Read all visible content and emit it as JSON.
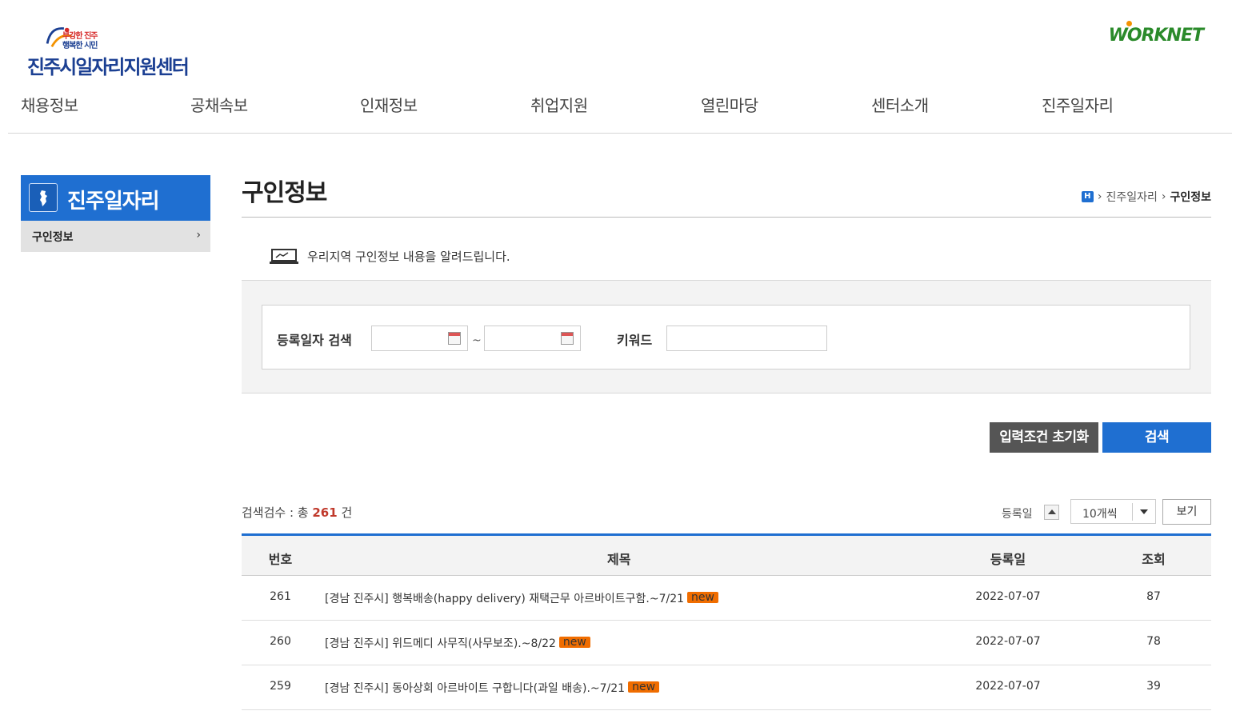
{
  "header": {
    "slogan_line1": "부강한 진주",
    "slogan_line2": "행복한 시민",
    "center_name": "진주시일자리지원센터",
    "worknet_logo": "WORKNET"
  },
  "gnb": [
    "채용정보",
    "공채속보",
    "인재정보",
    "취업지원",
    "열린마당",
    "센터소개",
    "진주일자리"
  ],
  "lnb": {
    "title": "진주일자리",
    "icon": "korea-map-icon",
    "items": [
      {
        "label": "구인정보"
      }
    ]
  },
  "page": {
    "title": "구인정보",
    "breadcrumb": [
      "진주일자리",
      "구인정보"
    ],
    "notice": "우리지역 구인정보 내용을 알려드립니다."
  },
  "search": {
    "date_label": "등록일자 검색",
    "tilde": "~",
    "keyword_label": "키워드",
    "start_date": "",
    "end_date": "",
    "keyword": "",
    "reset_button": "입력조건 초기화",
    "search_button": "검색"
  },
  "results": {
    "count_prefix": "검색검수 : 총",
    "count": "261",
    "count_suffix": "건",
    "sort_label": "등록일",
    "per_page": "10개씩",
    "view_button": "보기"
  },
  "table": {
    "headers": {
      "no": "번호",
      "title": "제목",
      "date": "등록일",
      "views": "조회"
    },
    "badge": "new",
    "rows": [
      {
        "no": "261",
        "title": "[경남 진주시] 행복배송(happy delivery) 재택근무 아르바이트구함.~7/21",
        "date": "2022-07-07",
        "views": "87"
      },
      {
        "no": "260",
        "title": "[경남 진주시] 위드메디 사무직(사무보조).~8/22",
        "date": "2022-07-07",
        "views": "78"
      },
      {
        "no": "259",
        "title": "[경남 진주시] 동아상회 아르바이트 구합니다(과일 배송).~7/21",
        "date": "2022-07-07",
        "views": "39"
      }
    ]
  },
  "colors": {
    "accent": "#1f6fd1",
    "dark_button": "#555555",
    "badge": "#f06d00",
    "count": "#c0392b"
  }
}
